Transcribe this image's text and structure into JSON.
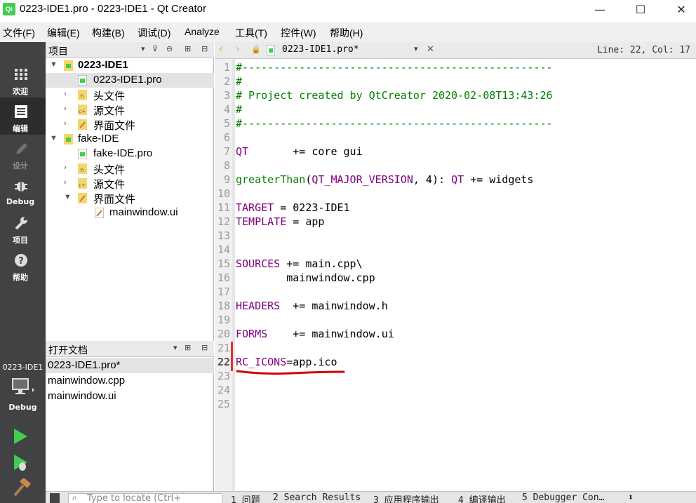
{
  "window": {
    "title": "0223-IDE1.pro - 0223-IDE1 - Qt Creator",
    "app_icon_text": "Qt",
    "minimize": "—",
    "maximize": "☐",
    "close": "✕"
  },
  "menubar": [
    "文件(F)",
    "编辑(E)",
    "构建(B)",
    "调试(D)",
    "Analyze",
    "工具(T)",
    "控件(W)",
    "帮助(H)"
  ],
  "modes": [
    {
      "label": "欢迎",
      "icon": "grid-icon"
    },
    {
      "label": "编辑",
      "icon": "document-icon"
    },
    {
      "label": "设计",
      "icon": "pencil-icon"
    },
    {
      "label": "Debug",
      "icon": "bug-icon"
    },
    {
      "label": "项目",
      "icon": "wrench-icon"
    },
    {
      "label": "帮助",
      "icon": "help-icon"
    }
  ],
  "target": {
    "project": "0223-IDE1",
    "mode": "Debug"
  },
  "projects_pane": {
    "title": "项目",
    "tree": [
      {
        "label": "0223-IDE1"
      },
      {
        "label": "0223-IDE1.pro"
      },
      {
        "label": "头文件"
      },
      {
        "label": "源文件"
      },
      {
        "label": "界面文件"
      },
      {
        "label": "fake-IDE"
      },
      {
        "label": "fake-IDE.pro"
      },
      {
        "label": "头文件"
      },
      {
        "label": "源文件"
      },
      {
        "label": "界面文件"
      },
      {
        "label": "mainwindow.ui"
      }
    ]
  },
  "open_docs": {
    "title": "打开文档",
    "items": [
      "0223-IDE1.pro*",
      "mainwindow.cpp",
      "mainwindow.ui"
    ]
  },
  "editor": {
    "file": "0223-IDE1.pro*",
    "cursor": "Line: 22, Col: 17",
    "current_line": 22,
    "lines": [
      "#-------------------------------------------------",
      "#",
      "# Project created by QtCreator 2020-02-08T13:43:26",
      "#",
      "#-------------------------------------------------",
      "",
      "QT       += core gui",
      "",
      "greaterThan(QT_MAJOR_VERSION, 4): QT += widgets",
      "",
      "TARGET = 0223-IDE1",
      "TEMPLATE = app",
      "",
      "",
      "SOURCES += main.cpp\\",
      "        mainwindow.cpp",
      "",
      "HEADERS  += mainwindow.h",
      "",
      "FORMS    += mainwindow.ui",
      "",
      "RC_ICONS=app.ico",
      "",
      "",
      ""
    ]
  },
  "statusbar": {
    "locator_placeholder": "Type to locate (Ctrl+",
    "tabs": [
      "1 问题",
      "2 Search Results",
      "3 应用程序输出",
      "4 编译输出",
      "5 Debugger Con…"
    ]
  },
  "colors": {
    "comment": "#008000",
    "keyword": "#800080",
    "annotation": "#d40000",
    "sidebar": "#404244"
  }
}
